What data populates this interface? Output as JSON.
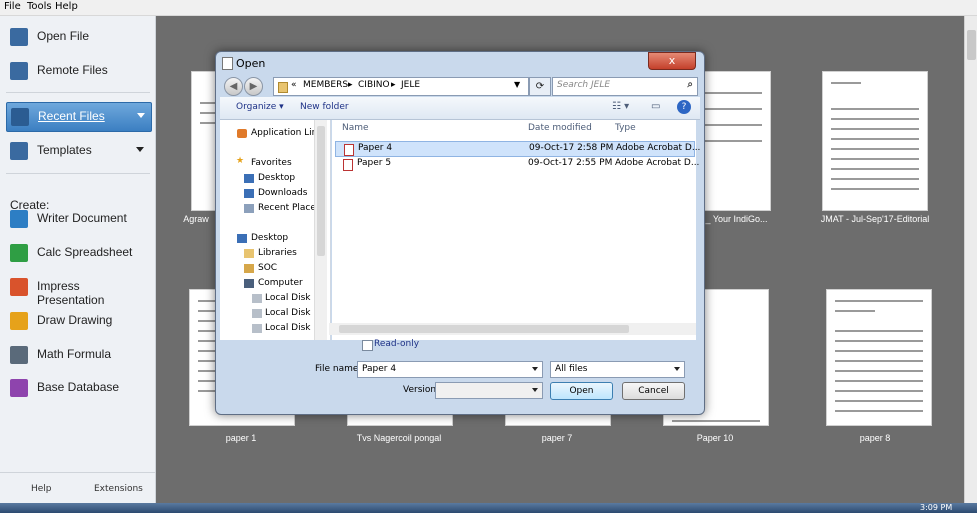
{
  "menubar": {
    "file": "File",
    "tools": "Tools",
    "help": "Help"
  },
  "sidebar": {
    "open_file": "Open File",
    "remote_files": "Remote Files",
    "recent_files": "Recent Files",
    "templates": "Templates",
    "create_label": "Create:",
    "writer": "Writer Document",
    "calc": "Calc Spreadsheet",
    "impress": "Impress Presentation",
    "draw": "Draw Drawing",
    "math": "Math Formula",
    "base": "Base Database",
    "help": "Help",
    "extensions": "Extensions"
  },
  "thumbs": {
    "t1": "Agraw",
    "t4": "d_ Your IndiGo...",
    "t5": "JMAT - Jul-Sep'17-Editorial",
    "b1": "paper 1",
    "b2": "Tvs Nagercoil pongal",
    "b3": "paper 7",
    "b4": "Paper 10",
    "b5": "paper 8"
  },
  "dialog": {
    "title": "Open",
    "close": "x",
    "breadcrumb": {
      "chev": "«",
      "p1": "MEMBERS",
      "p2": "CIBINO",
      "p3": "JELE",
      "sep": "▸"
    },
    "search_placeholder": "Search JELE",
    "toolbar": {
      "organize": "Organize ▾",
      "new_folder": "New folder",
      "help": "?"
    },
    "nav": {
      "application_links": "Application Links",
      "favorites": "Favorites",
      "desktop": "Desktop",
      "downloads": "Downloads",
      "recent_places": "Recent Places",
      "desktop2": "Desktop",
      "libraries": "Libraries",
      "soc": "SOC",
      "computer": "Computer",
      "disk_c": "Local Disk (C",
      "disk_d": "Local Disk (D",
      "disk_e": "Local Disk (E:"
    },
    "columns": {
      "name": "Name",
      "date": "Date modified",
      "type": "Type"
    },
    "files": [
      {
        "name": "Paper 4",
        "date": "09-Oct-17 2:58 PM",
        "type": "Adobe Acrobat D..."
      },
      {
        "name": "Paper 5",
        "date": "09-Oct-17 2:55 PM",
        "type": "Adobe Acrobat D..."
      }
    ],
    "read_only": "Read-only",
    "file_name_label": "File name:",
    "file_name_value": "Paper 4",
    "filter_value": "All files",
    "version_label": "Version",
    "open_btn": "Open",
    "cancel_btn": "Cancel"
  },
  "taskbar": {
    "time": "3:09 PM"
  },
  "colors": {
    "accent": "#3b7fc2",
    "background": "#6d6d6d",
    "dialog_frame": "#c9d9ec"
  }
}
